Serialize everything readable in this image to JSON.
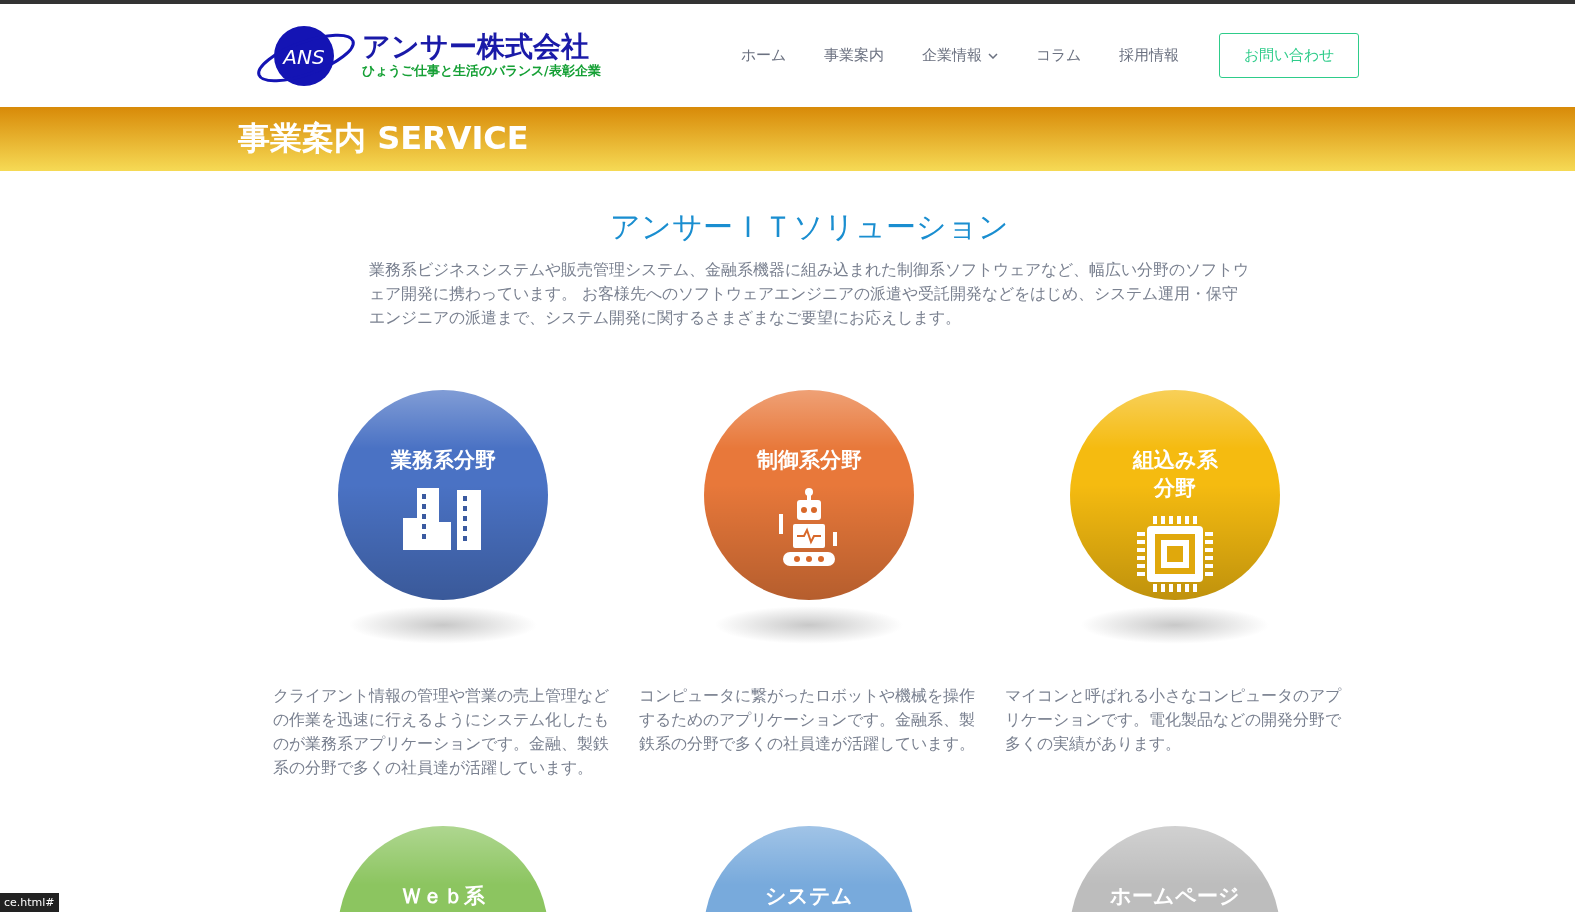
{
  "logo": {
    "mark": "ANS",
    "name": "アンサー株式会社",
    "tagline": "ひょうご仕事と生活のバランス/表彰企業"
  },
  "nav": [
    {
      "label": "ホーム",
      "dropdown": false
    },
    {
      "label": "事業案内",
      "dropdown": false
    },
    {
      "label": "企業情報",
      "dropdown": true
    },
    {
      "label": "コラム",
      "dropdown": false
    },
    {
      "label": "採用情報",
      "dropdown": false
    }
  ],
  "contact_button": "お問い合わせ",
  "banner": {
    "title": "事業案内 SERVICE"
  },
  "section": {
    "title": "アンサーＩＴソリューション",
    "intro": "業務系ビジネスシステムや販売管理システム、金融系機器に組み込まれた制御系ソフトウェアなど、幅広い分野のソフトウェア開発に携わっています。 お客様先へのソフトウェアエンジニアの派遣や受託開発などをはじめ、システム運用・保守エンジニアの派遣まで、システム開発に関するさまざまなご要望にお応えします。"
  },
  "services": [
    {
      "title": [
        "業務系分野"
      ],
      "kind": "buildings",
      "color": "#4a72c4",
      "description": "クライアント情報の管理や営業の売上管理などの作業を迅速に行えるようにシステム化したものが業務系アプリケーションです。金融、製鉄系の分野で多くの社員達が活躍しています。"
    },
    {
      "title": [
        "制御系分野"
      ],
      "kind": "robot",
      "color": "#e8783a",
      "description": "コンピュータに繋がったロボットや機械を操作するためのアプリケーションです。金融系、製鉄系の分野で多くの社員達が活躍しています。"
    },
    {
      "title": [
        "組込み系",
        "分野"
      ],
      "kind": "chip",
      "color": "#f5bb10",
      "description": "マイコンと呼ばれる小さなコンピュータのアプリケーションです。電化製品などの開発分野で多くの実績があります。"
    },
    {
      "title": [
        "Ｗｅｂ系"
      ],
      "kind": "none",
      "color": "#8cc560"
    },
    {
      "title": [
        "システム"
      ],
      "kind": "none",
      "color": "#78aadc"
    },
    {
      "title": [
        "ホームページ"
      ],
      "kind": "none",
      "color": "#bdbdbd"
    }
  ],
  "status_bar": "ce.html#"
}
